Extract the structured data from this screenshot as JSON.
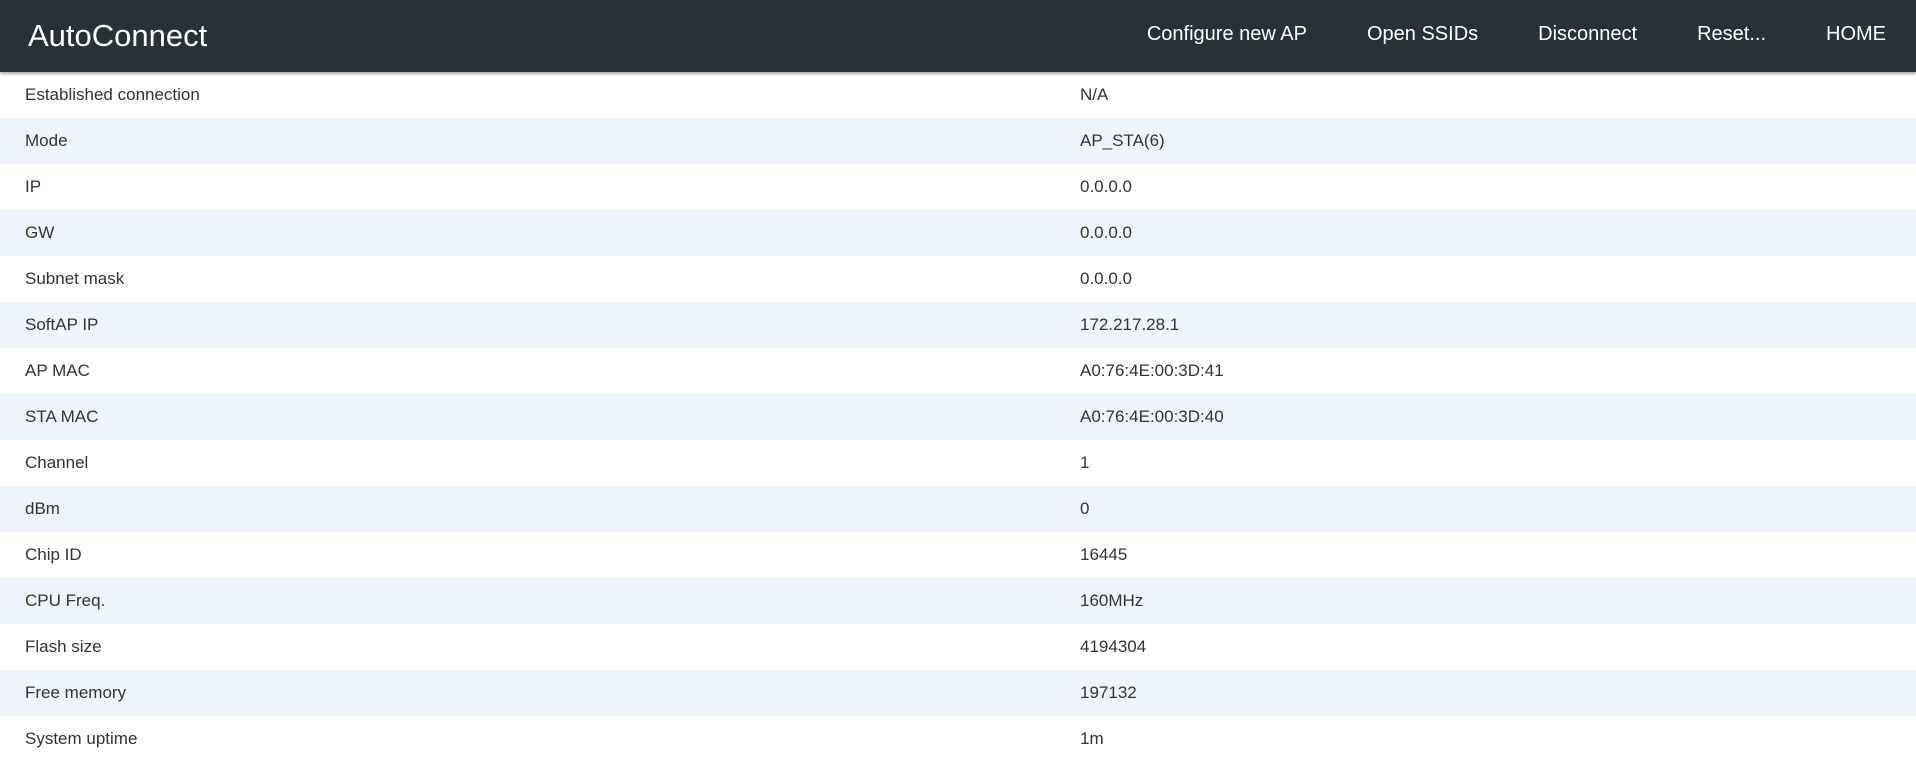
{
  "app": {
    "title": "AutoConnect"
  },
  "menu": {
    "items": [
      {
        "label": "Configure new AP"
      },
      {
        "label": "Open SSIDs"
      },
      {
        "label": "Disconnect"
      },
      {
        "label": "Reset..."
      },
      {
        "label": "HOME"
      }
    ]
  },
  "status": {
    "rows": [
      {
        "label": "Established connection",
        "value": "N/A"
      },
      {
        "label": "Mode",
        "value": "AP_STA(6)"
      },
      {
        "label": "IP",
        "value": "0.0.0.0"
      },
      {
        "label": "GW",
        "value": "0.0.0.0"
      },
      {
        "label": "Subnet mask",
        "value": "0.0.0.0"
      },
      {
        "label": "SoftAP IP",
        "value": "172.217.28.1"
      },
      {
        "label": "AP MAC",
        "value": "A0:76:4E:00:3D:41"
      },
      {
        "label": "STA MAC",
        "value": "A0:76:4E:00:3D:40"
      },
      {
        "label": "Channel",
        "value": "1"
      },
      {
        "label": "dBm",
        "value": "0"
      },
      {
        "label": "Chip ID",
        "value": "16445"
      },
      {
        "label": "CPU Freq.",
        "value": "160MHz"
      },
      {
        "label": "Flash size",
        "value": "4194304"
      },
      {
        "label": "Free memory",
        "value": "197132"
      },
      {
        "label": "System uptime",
        "value": "1m"
      }
    ]
  }
}
